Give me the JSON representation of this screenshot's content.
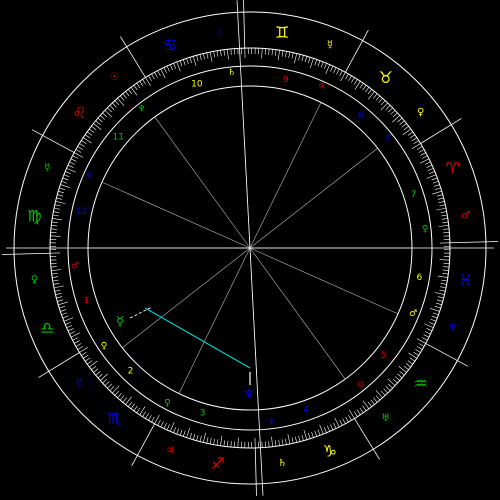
{
  "colors": {
    "background": "#000000",
    "line": "#ffffff",
    "fire": "#e00000",
    "earth": "#ffff00",
    "air": "#00c800",
    "water": "#0000ff",
    "aspect_line": "#00cccc"
  },
  "signs": [
    {
      "glyph": "♌",
      "color": "#e00000",
      "icon": "leo-icon"
    },
    {
      "glyph": "♋",
      "color": "#0000ff",
      "icon": "cancer-icon"
    },
    {
      "glyph": "♊",
      "color": "#ffff00",
      "icon": "gemini-icon"
    },
    {
      "glyph": "♉",
      "color": "#ffff00",
      "icon": "taurus-icon"
    },
    {
      "glyph": "♈",
      "color": "#e00000",
      "icon": "aries-icon"
    },
    {
      "glyph": "♓",
      "color": "#0000ff",
      "icon": "pisces-icon"
    },
    {
      "glyph": "♒",
      "color": "#00c800",
      "icon": "aquarius-icon"
    },
    {
      "glyph": "♑",
      "color": "#ffff00",
      "icon": "capricorn-icon"
    },
    {
      "glyph": "♐",
      "color": "#e00000",
      "icon": "sagittarius-icon"
    },
    {
      "glyph": "♏",
      "color": "#0000ff",
      "icon": "scorpio-icon"
    },
    {
      "glyph": "♎",
      "color": "#00c800",
      "icon": "libra-icon"
    },
    {
      "glyph": "♍",
      "color": "#00c800",
      "icon": "virgo-icon"
    }
  ],
  "rulers": [
    {
      "glyph": "☉",
      "color": "#e00000",
      "icon": "sun-ruler-icon"
    },
    {
      "glyph": "☽",
      "color": "#0000ff",
      "icon": "moon-ruler-icon"
    },
    {
      "glyph": "☿",
      "color": "#ffff00",
      "icon": "mercury-ruler-icon"
    },
    {
      "glyph": "♀",
      "color": "#ffff00",
      "icon": "venus-ruler-icon"
    },
    {
      "glyph": "♂",
      "color": "#e00000",
      "icon": "mars-ruler-icon"
    },
    {
      "glyph": "♆",
      "color": "#0000ff",
      "icon": "neptune-ruler-icon"
    },
    {
      "glyph": "♅",
      "color": "#00c800",
      "icon": "uranus-ruler-icon"
    },
    {
      "glyph": "♄",
      "color": "#ffff00",
      "icon": "saturn-ruler-icon"
    },
    {
      "glyph": "♃",
      "color": "#e00000",
      "icon": "jupiter-ruler-icon"
    },
    {
      "glyph": "♇",
      "color": "#0000ff",
      "icon": "pluto-ruler-icon"
    },
    {
      "glyph": "♀",
      "color": "#00c800",
      "icon": "venus-ruler-icon"
    },
    {
      "glyph": "☿",
      "color": "#00c800",
      "icon": "mercury-ruler-icon"
    }
  ],
  "houses": [
    {
      "number": "1",
      "color": "#e00000"
    },
    {
      "number": "2",
      "color": "#ffff00"
    },
    {
      "number": "3",
      "color": "#00c800"
    },
    {
      "number": "4",
      "color": "#0000ff"
    },
    {
      "number": "5",
      "color": "#e00000"
    },
    {
      "number": "6",
      "color": "#ffff00"
    },
    {
      "number": "7",
      "color": "#00c800"
    },
    {
      "number": "8",
      "color": "#0000ff"
    },
    {
      "number": "9",
      "color": "#e00000"
    },
    {
      "number": "10",
      "color": "#ffff00"
    },
    {
      "number": "11",
      "color": "#00c800"
    },
    {
      "number": "12",
      "color": "#0000ff"
    }
  ],
  "cusp_rulers": [
    {
      "glyph": "♂",
      "color": "#e00000",
      "icon": "mars-cusp-icon"
    },
    {
      "glyph": "♀",
      "color": "#ffff00",
      "icon": "venus-cusp-icon"
    },
    {
      "glyph": "♀",
      "color": "#00c800",
      "icon": "venus-cusp-icon"
    },
    {
      "glyph": "♆",
      "color": "#0000ff",
      "icon": "neptune-cusp-icon"
    },
    {
      "glyph": "⊙",
      "color": "#e00000",
      "icon": "sun-cusp-icon"
    },
    {
      "glyph": "♂",
      "color": "#ffff00",
      "icon": "mars-cusp-icon"
    },
    {
      "glyph": "♀",
      "color": "#00c800",
      "icon": "venus-cusp-icon"
    },
    {
      "glyph": "♇",
      "color": "#0000ff",
      "icon": "pluto-cusp-icon"
    },
    {
      "glyph": "♃",
      "color": "#e00000",
      "icon": "jupiter-cusp-icon"
    },
    {
      "glyph": "♄",
      "color": "#ffff00",
      "icon": "saturn-cusp-icon"
    },
    {
      "glyph": "♆",
      "color": "#00c800",
      "icon": "neptune-cusp-icon"
    },
    {
      "glyph": "♆",
      "color": "#0000ff",
      "icon": "neptune-cusp-icon"
    }
  ],
  "planets": [
    {
      "glyph": "☿",
      "color": "#00c800",
      "icon": "mercury-planet-icon"
    },
    {
      "glyph": "♆",
      "color": "#0000ff",
      "icon": "neptune-planet-icon"
    }
  ]
}
